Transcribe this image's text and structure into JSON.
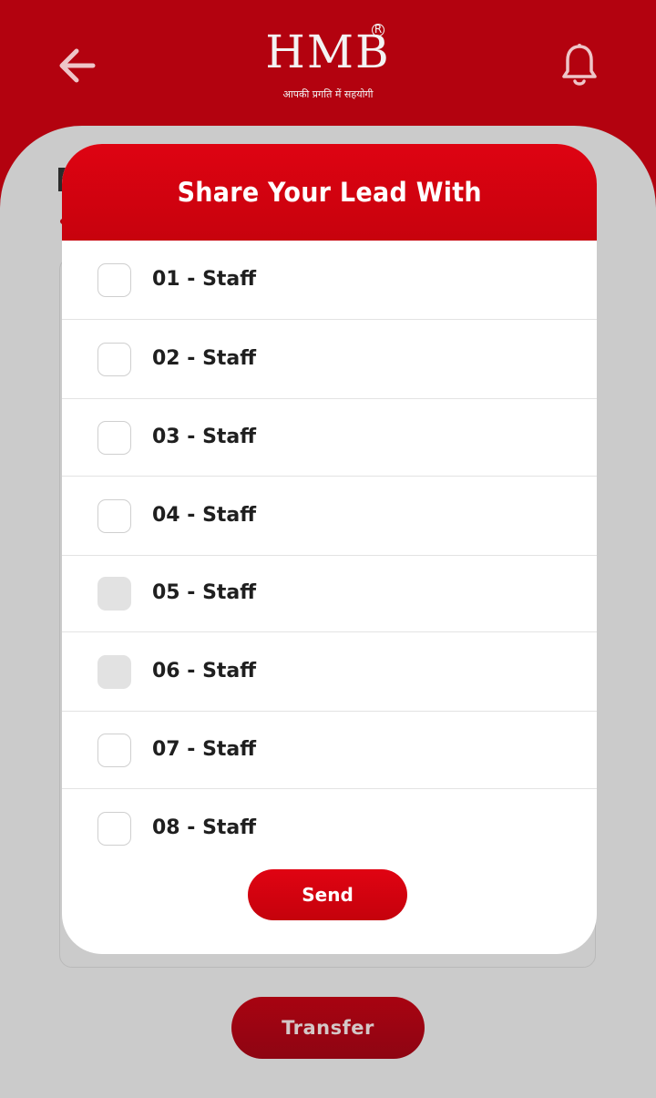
{
  "header": {
    "logo_text": "HMB",
    "logo_registered": "R",
    "logo_tagline": "आपकी प्रगति में सहयोगी",
    "back_icon": "back-arrow-icon",
    "notification_icon": "bell-icon"
  },
  "modal": {
    "title": "Share Your Lead With",
    "staff": [
      {
        "label": "01 - Staff",
        "checked": false,
        "disabled": false
      },
      {
        "label": "02 - Staff",
        "checked": false,
        "disabled": false
      },
      {
        "label": "03 - Staff",
        "checked": false,
        "disabled": false
      },
      {
        "label": "04 - Staff",
        "checked": false,
        "disabled": false
      },
      {
        "label": "05 - Staff",
        "checked": false,
        "disabled": true
      },
      {
        "label": "06 - Staff",
        "checked": false,
        "disabled": true
      },
      {
        "label": "07 - Staff",
        "checked": false,
        "disabled": false
      },
      {
        "label": "08 - Staff",
        "checked": false,
        "disabled": false
      }
    ],
    "send_label": "Send"
  },
  "page": {
    "transfer_label": "Transfer"
  },
  "colors": {
    "brand_red": "#b3020f",
    "modal_red": "#de0312",
    "overlay_gray": "#cbcbcb"
  }
}
